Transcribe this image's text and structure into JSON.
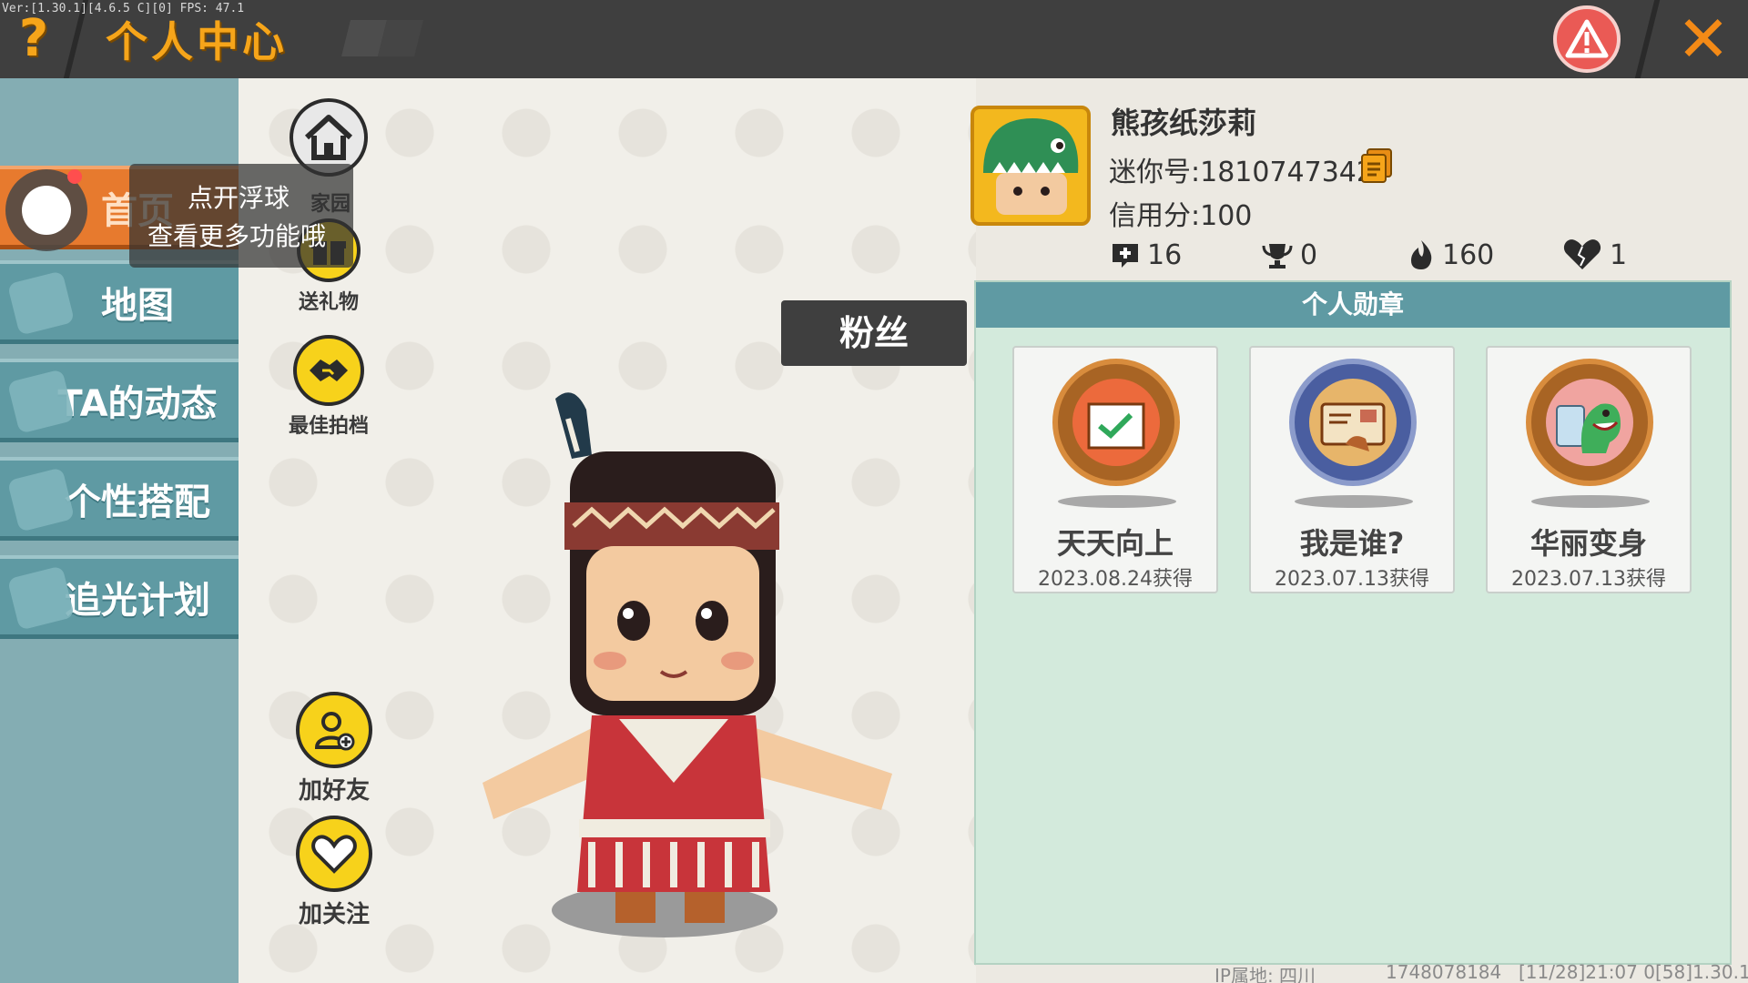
{
  "header": {
    "version": "Ver:[1.30.1][4.6.5 C][0] FPS: 47.1",
    "help": "?",
    "title": "个人中心",
    "close": "✕"
  },
  "sidebar": {
    "items": [
      {
        "label": "首页",
        "active": true
      },
      {
        "label": "地图",
        "active": false
      },
      {
        "label": "TA的动态",
        "active": false
      },
      {
        "label": "个性搭配",
        "active": false
      },
      {
        "label": "追光计划",
        "active": false
      }
    ]
  },
  "float_tip": {
    "line1": "点开浮球",
    "line2": "查看更多功能哦"
  },
  "actions": {
    "home": "家园",
    "gift": "送礼物",
    "best_photo": "最佳拍档",
    "add_friend": "加好友",
    "follow": "加关注"
  },
  "fans_tag": "粉丝",
  "profile": {
    "nickname": "熊孩纸莎莉",
    "mini_id": "迷你号:1810747342",
    "credit": "信用分:100",
    "stats": {
      "plus": "16",
      "trophy": "0",
      "fire": "160",
      "heart": "1"
    }
  },
  "medals": {
    "title": "个人勋章",
    "items": [
      {
        "name": "天天向上",
        "date": "2023.08.24获得"
      },
      {
        "name": "我是谁?",
        "date": "2023.07.13获得"
      },
      {
        "name": "华丽变身",
        "date": "2023.07.13获得"
      }
    ]
  },
  "footer": {
    "ip": "IP属地: 四川",
    "uid": "1748078184",
    "time": "[11/28]21:07 0",
    "build": "[58]1.30.1"
  },
  "colors": {
    "accent_orange": "#f6a51a",
    "sidebar_teal": "#5f9aa3",
    "active_orange": "#e77a2e",
    "medal_panel_green": "#d3eadc",
    "topbar": "#3f3f3f"
  }
}
